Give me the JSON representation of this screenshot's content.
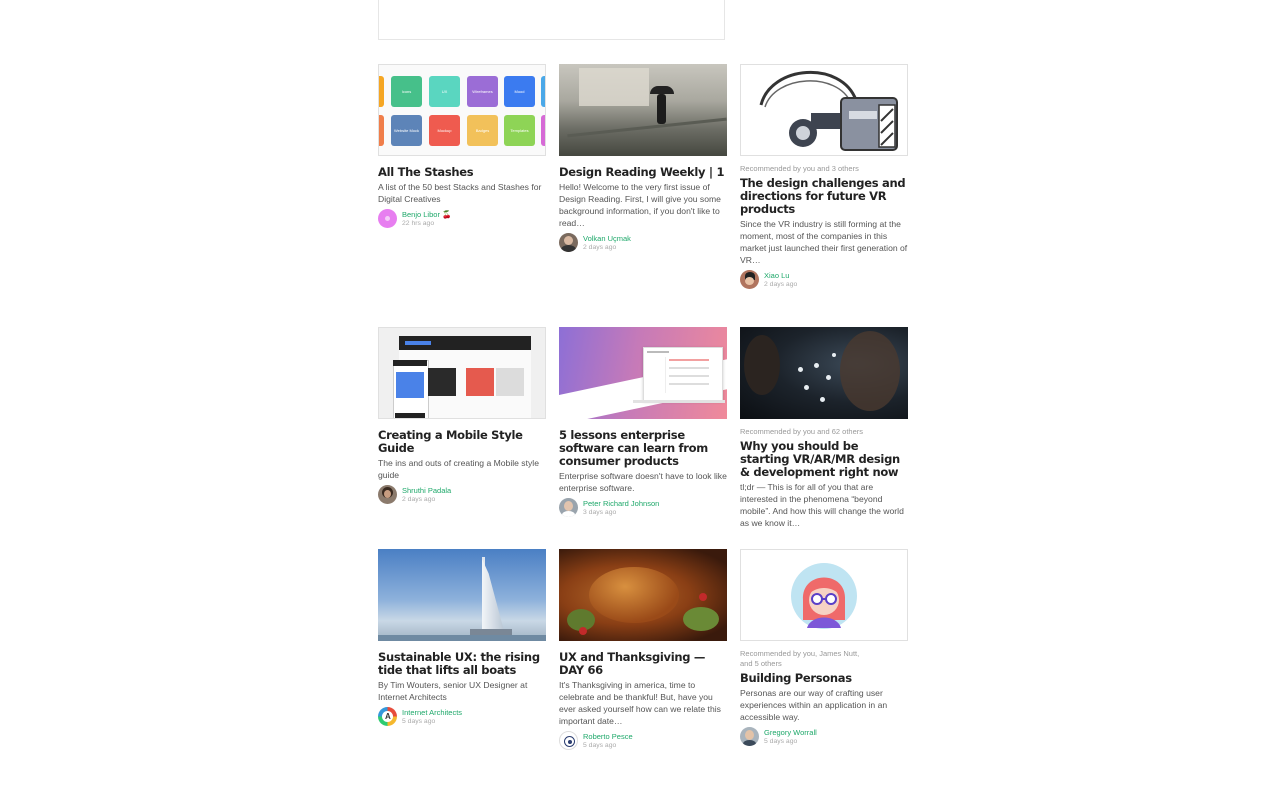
{
  "cards": [
    {
      "title": "All The Stashes",
      "excerpt": "A list of the 50 best Stacks and Stashes for Digital Creatives",
      "author": "Benjo Libor 🍒",
      "date": "22 hrs ago",
      "tiles": [
        "Icons",
        "UX",
        "Wireframes",
        "Mood",
        "Website Mock",
        "Mockup",
        "Badges",
        "Templates"
      ]
    },
    {
      "title": "Design Reading Weekly | 1",
      "excerpt": "Hello! Welcome to the very first issue of Design Reading. First, I will give you some background information, if you don't like to read…",
      "author": "Volkan Uçmak",
      "date": "2 days ago"
    },
    {
      "recommended": "Recommended by you and 3 others",
      "title": "The design challenges and directions for future VR products",
      "excerpt": "Since the VR industry is still forming at the moment, most of the companies in this market just launched their first generation of VR…",
      "author": "Xiao Lu",
      "date": "2 days ago"
    },
    {
      "title": "Creating a Mobile Style Guide",
      "excerpt": "The ins and outs of creating a Mobile style guide",
      "author": "Shruthi Padala",
      "date": "2 days ago"
    },
    {
      "title": "5 lessons enterprise software can learn from consumer products",
      "excerpt": "Enterprise software doesn't have to look like enterprise software.",
      "author": "Peter Richard Johnson",
      "date": "3 days ago"
    },
    {
      "recommended": "Recommended by you and 62 others",
      "title": "Why you should be starting VR/AR/MR design & development right now",
      "excerpt": "tl;dr — This is for all of you that are interested in the phenomena “beyond mobile”. And how this will change the world as we know it…",
      "author": "",
      "date": ""
    },
    {
      "title": "Sustainable UX: the rising tide that lifts all boats",
      "excerpt": "By Tim Wouters, senior UX Designer at Internet Architects",
      "author": "Internet Architects",
      "date": "5 days ago"
    },
    {
      "title": "UX and Thanksgiving — DAY 66",
      "excerpt": "It's Thanksgiving in america, time to celebrate and be thankful! But, have you ever asked yourself how can we relate this important date…",
      "author": "Roberto Pesce",
      "date": "5 days ago"
    },
    {
      "recommended": "Recommended by you, James Nutt, and 5 others",
      "title": "Building Personas",
      "excerpt": "Personas are our way of crafting user experiences within an application in an accessible way.",
      "author": "Gregory Worrall",
      "date": "5 days ago"
    }
  ],
  "colors": {
    "accent": "#1ea86a"
  }
}
